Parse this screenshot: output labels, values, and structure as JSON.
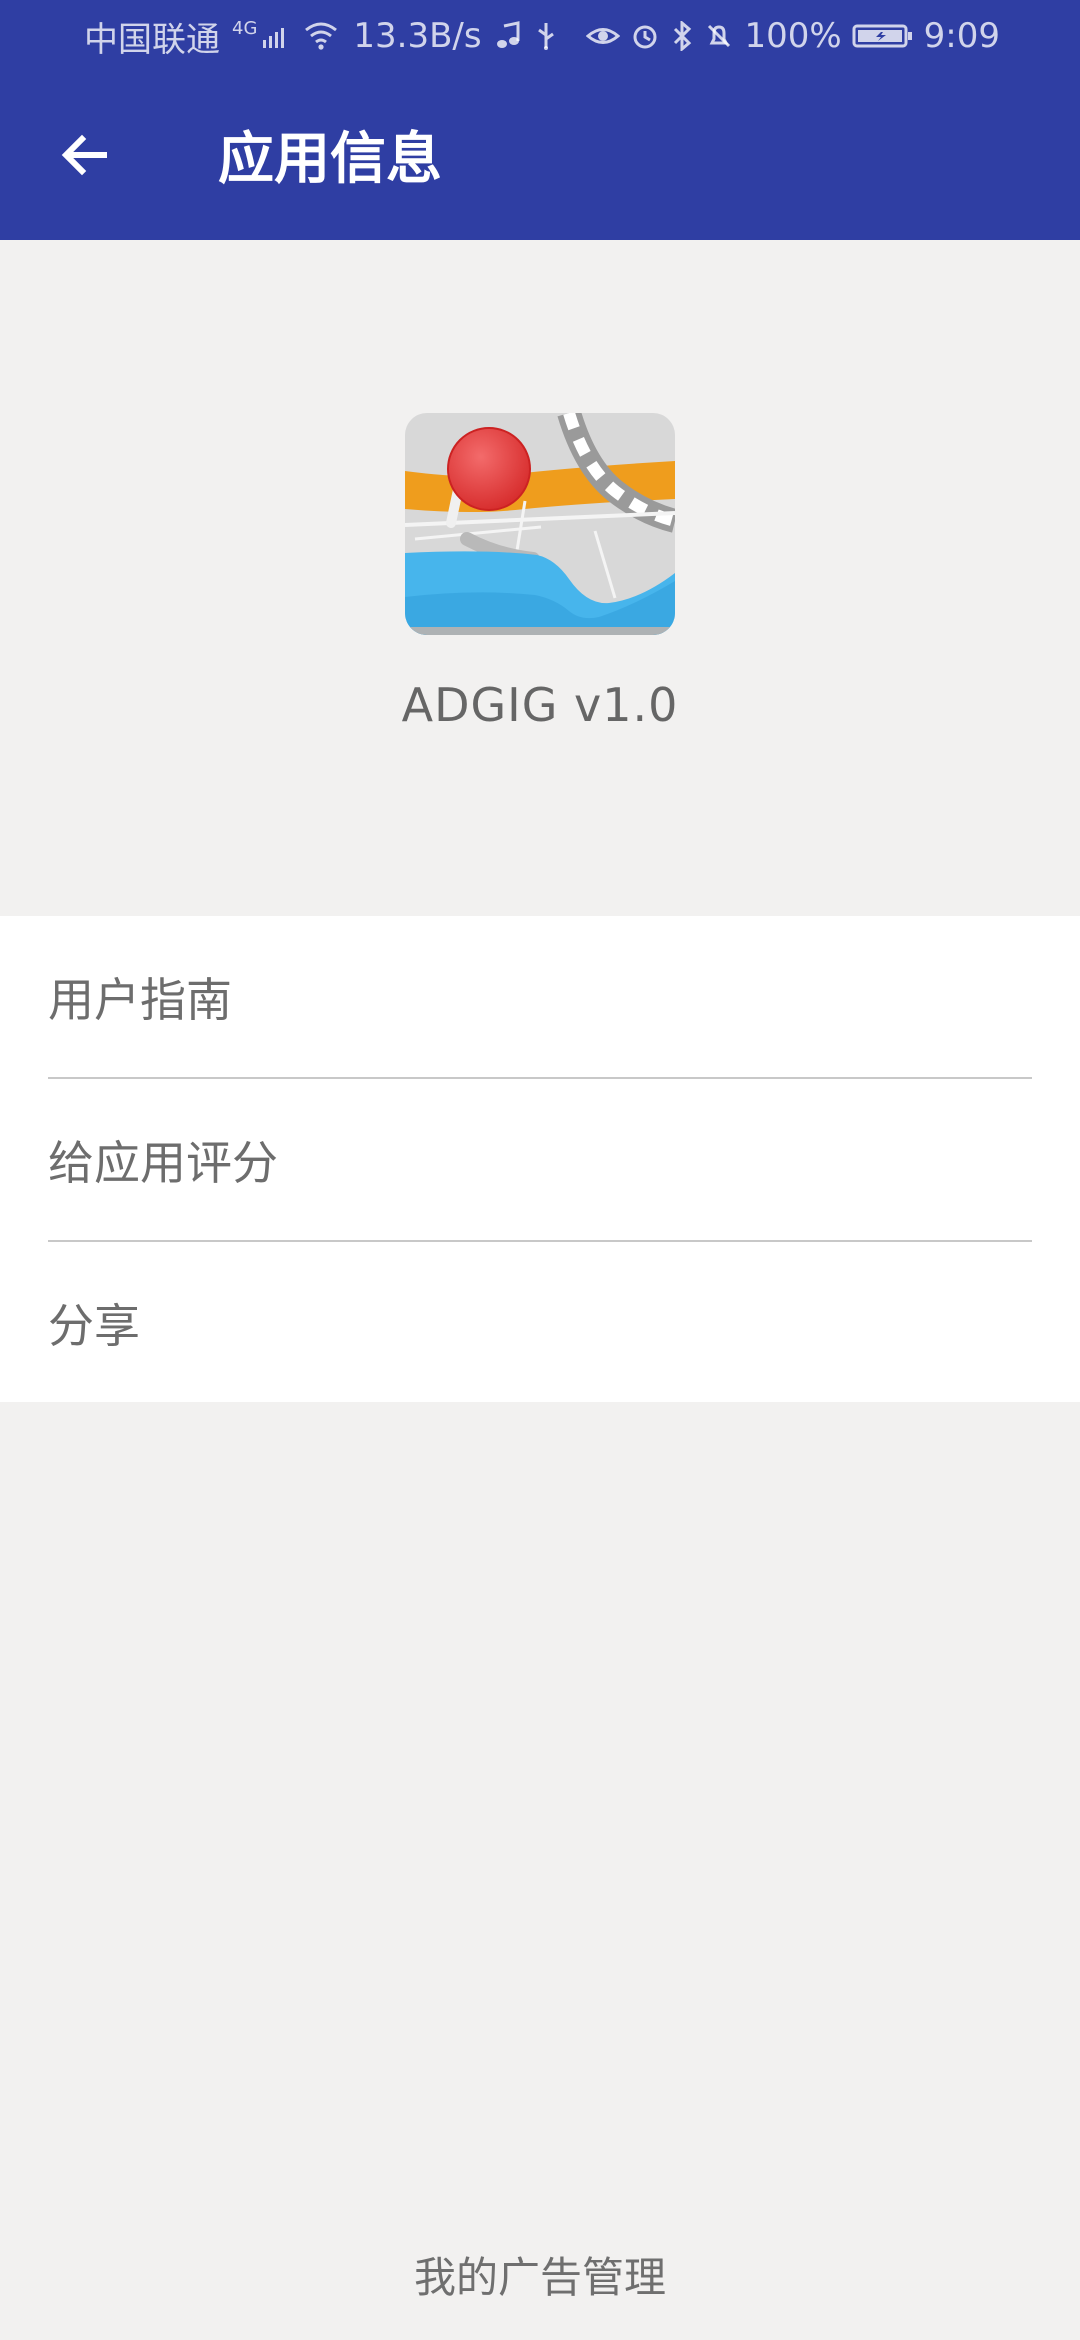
{
  "status_bar": {
    "carrier": "中国联通",
    "network_badge": "4G",
    "speed": "13.3B/s",
    "battery": "100%",
    "time": "9:09",
    "icons": [
      "signal-icon",
      "wifi-icon",
      "music-icon",
      "usb-icon",
      "eye-icon",
      "alarm-icon",
      "bluetooth-icon",
      "bell-off-icon",
      "battery-icon"
    ]
  },
  "header": {
    "title": "应用信息",
    "back_icon": "back-arrow-icon",
    "background": "#2f3ea3"
  },
  "app": {
    "name_version": "ADGIG  v1.0",
    "icon": "map-pin-icon"
  },
  "menu": {
    "items": [
      {
        "label": "用户指南"
      },
      {
        "label": "给应用评分"
      },
      {
        "label": "分享"
      }
    ]
  },
  "footer": {
    "link": "我的广告管理"
  },
  "colors": {
    "page_background": "#f2f1f0",
    "text_secondary": "#6d6d6d",
    "accent": "#2f3ea3"
  }
}
